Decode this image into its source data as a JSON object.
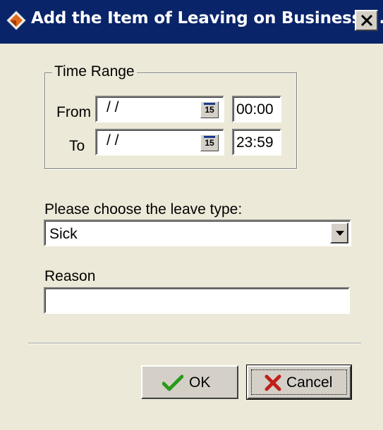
{
  "window": {
    "title": "Add the Item of Leaving on Business/..."
  },
  "time_range": {
    "legend": "Time Range",
    "from_label": "From",
    "to_label": "To",
    "from_date": "/ /",
    "from_time": "00:00",
    "to_date": "/ /",
    "to_time": "23:59",
    "calendar_glyph": "15"
  },
  "leave_type": {
    "label": "Please choose the leave type:",
    "selected": "Sick"
  },
  "reason": {
    "label": "Reason",
    "value": ""
  },
  "buttons": {
    "ok_label": "OK",
    "cancel_label": "Cancel"
  },
  "colors": {
    "titlebar": "#0a246a",
    "window_bg": "#ece9d8",
    "ok_check": "#2a9a1a",
    "cancel_x": "#c0201a"
  }
}
